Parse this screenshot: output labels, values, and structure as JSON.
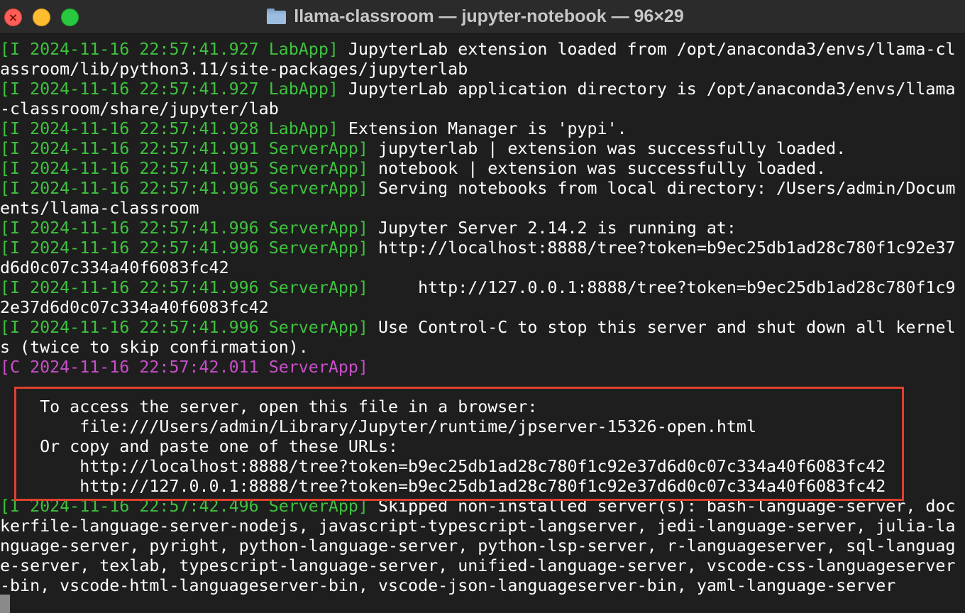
{
  "window": {
    "title": "llama-classroom — jupyter-notebook — 96×29"
  },
  "colors": {
    "tag_info": "#3fc23f",
    "tag_critical": "#c94fc9",
    "text": "#ffffff",
    "highlight_border": "#e0402f",
    "background": "#1e1e1e"
  },
  "terminal": {
    "lines": [
      {
        "tag": "[I 2024-11-16 22:57:41.927 LabApp]",
        "tag_color": "green",
        "text": " JupyterLab extension loaded from /opt/anaconda3/envs/llama-cl"
      },
      {
        "tag": "",
        "tag_color": "green",
        "text": "assroom/lib/python3.11/site-packages/jupyterlab"
      },
      {
        "tag": "[I 2024-11-16 22:57:41.927 LabApp]",
        "tag_color": "green",
        "text": " JupyterLab application directory is /opt/anaconda3/envs/llama"
      },
      {
        "tag": "",
        "tag_color": "green",
        "text": "-classroom/share/jupyter/lab"
      },
      {
        "tag": "[I 2024-11-16 22:57:41.928 LabApp]",
        "tag_color": "green",
        "text": " Extension Manager is 'pypi'."
      },
      {
        "tag": "[I 2024-11-16 22:57:41.991 ServerApp]",
        "tag_color": "green",
        "text": " jupyterlab | extension was successfully loaded."
      },
      {
        "tag": "[I 2024-11-16 22:57:41.995 ServerApp]",
        "tag_color": "green",
        "text": " notebook | extension was successfully loaded."
      },
      {
        "tag": "[I 2024-11-16 22:57:41.996 ServerApp]",
        "tag_color": "green",
        "text": " Serving notebooks from local directory: /Users/admin/Docum"
      },
      {
        "tag": "",
        "tag_color": "green",
        "text": "ents/llama-classroom"
      },
      {
        "tag": "[I 2024-11-16 22:57:41.996 ServerApp]",
        "tag_color": "green",
        "text": " Jupyter Server 2.14.2 is running at:"
      },
      {
        "tag": "[I 2024-11-16 22:57:41.996 ServerApp]",
        "tag_color": "green",
        "text": " http://localhost:8888/tree?token=b9ec25db1ad28c780f1c92e37"
      },
      {
        "tag": "",
        "tag_color": "green",
        "text": "d6d0c07c334a40f6083fc42"
      },
      {
        "tag": "[I 2024-11-16 22:57:41.996 ServerApp]",
        "tag_color": "green",
        "text": "     http://127.0.0.1:8888/tree?token=b9ec25db1ad28c780f1c9"
      },
      {
        "tag": "",
        "tag_color": "green",
        "text": "2e37d6d0c07c334a40f6083fc42"
      },
      {
        "tag": "[I 2024-11-16 22:57:41.996 ServerApp]",
        "tag_color": "green",
        "text": " Use Control-C to stop this server and shut down all kernel"
      },
      {
        "tag": "",
        "tag_color": "green",
        "text": "s (twice to skip confirmation)."
      },
      {
        "tag": "[C 2024-11-16 22:57:42.011 ServerApp]",
        "tag_color": "magenta",
        "text": ""
      },
      {
        "tag": "",
        "tag_color": "green",
        "text": ""
      },
      {
        "tag": "",
        "tag_color": "green",
        "text": "    To access the server, open this file in a browser:"
      },
      {
        "tag": "",
        "tag_color": "green",
        "text": "        file:///Users/admin/Library/Jupyter/runtime/jpserver-15326-open.html"
      },
      {
        "tag": "",
        "tag_color": "green",
        "text": "    Or copy and paste one of these URLs:"
      },
      {
        "tag": "",
        "tag_color": "green",
        "text": "        http://localhost:8888/tree?token=b9ec25db1ad28c780f1c92e37d6d0c07c334a40f6083fc42"
      },
      {
        "tag": "",
        "tag_color": "green",
        "text": "        http://127.0.0.1:8888/tree?token=b9ec25db1ad28c780f1c92e37d6d0c07c334a40f6083fc42"
      },
      {
        "tag": "[I 2024-11-16 22:57:42.496 ServerApp]",
        "tag_color": "green",
        "text": " Skipped non-installed server(s): bash-language-server, doc"
      },
      {
        "tag": "",
        "tag_color": "green",
        "text": "kerfile-language-server-nodejs, javascript-typescript-langserver, jedi-language-server, julia-la"
      },
      {
        "tag": "",
        "tag_color": "green",
        "text": "nguage-server, pyright, python-language-server, python-lsp-server, r-languageserver, sql-languag"
      },
      {
        "tag": "",
        "tag_color": "green",
        "text": "e-server, texlab, typescript-language-server, unified-language-server, vscode-css-languageserver"
      },
      {
        "tag": "",
        "tag_color": "green",
        "text": "-bin, vscode-html-languageserver-bin, vscode-json-languageserver-bin, yaml-language-server"
      }
    ]
  }
}
